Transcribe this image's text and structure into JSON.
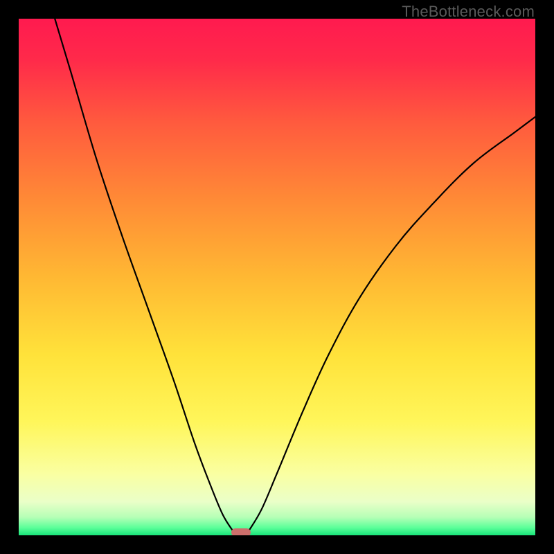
{
  "watermark": "TheBottleneck.com",
  "chart_data": {
    "type": "line",
    "title": "",
    "xlabel": "",
    "ylabel": "",
    "xlim": [
      0,
      100
    ],
    "ylim": [
      0,
      100
    ],
    "series": [
      {
        "name": "curve-left",
        "x": [
          7.0,
          10,
          15,
          20,
          25,
          30,
          34,
          37,
          39.5,
          41.5
        ],
        "values": [
          100,
          90,
          73,
          58,
          44,
          30,
          18,
          10,
          4,
          0.8
        ]
      },
      {
        "name": "curve-right",
        "x": [
          44.5,
          47,
          50,
          55,
          60,
          66,
          73,
          80,
          88,
          96,
          100
        ],
        "values": [
          0.8,
          5,
          12,
          24,
          35,
          46,
          56,
          64,
          72,
          78,
          81
        ]
      }
    ],
    "marker": {
      "x": 43,
      "y": 0.5,
      "color": "#cd6f6c"
    },
    "gradient_stops": [
      {
        "pos": 0.0,
        "color": "#ff1a4f"
      },
      {
        "pos": 0.08,
        "color": "#ff2a4a"
      },
      {
        "pos": 0.2,
        "color": "#ff5a3e"
      },
      {
        "pos": 0.35,
        "color": "#ff8a36"
      },
      {
        "pos": 0.5,
        "color": "#ffb833"
      },
      {
        "pos": 0.65,
        "color": "#ffe23a"
      },
      {
        "pos": 0.78,
        "color": "#fff65a"
      },
      {
        "pos": 0.88,
        "color": "#faffa1"
      },
      {
        "pos": 0.935,
        "color": "#eaffc8"
      },
      {
        "pos": 0.965,
        "color": "#b6ffb6"
      },
      {
        "pos": 0.985,
        "color": "#5cff9a"
      },
      {
        "pos": 1.0,
        "color": "#18e47a"
      }
    ]
  }
}
